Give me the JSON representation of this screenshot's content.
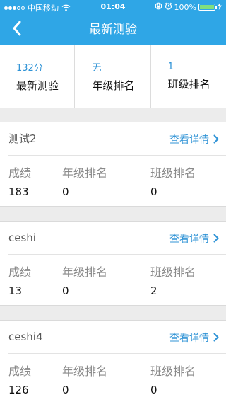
{
  "status_bar": {
    "carrier": "中国移动",
    "time": "01:04",
    "battery": "100%"
  },
  "nav": {
    "title": "最新测验",
    "back_icon": "chevron-left-icon"
  },
  "summary": [
    {
      "value": "132分",
      "label": "最新测验"
    },
    {
      "value": "无",
      "label": "年级排名"
    },
    {
      "value": "1",
      "label": "班级排名"
    }
  ],
  "exam_link_label": "查看详情",
  "exams": [
    {
      "name": "测试2",
      "score_label": "成绩",
      "grade_rank_label": "年级排名",
      "class_rank_label": "班级排名",
      "score": "183",
      "grade_rank": "0",
      "class_rank": "0"
    },
    {
      "name": "ceshi",
      "score_label": "成绩",
      "grade_rank_label": "年级排名",
      "class_rank_label": "班级排名",
      "score": "13",
      "grade_rank": "0",
      "class_rank": "2"
    },
    {
      "name": "ceshi4",
      "score_label": "成绩",
      "grade_rank_label": "年级排名",
      "class_rank_label": "班级排名",
      "score": "126",
      "grade_rank": "0",
      "class_rank": "0"
    }
  ],
  "colors": {
    "header": "#2fa6e6",
    "accent": "#2f93d6",
    "background": "#ececec"
  }
}
